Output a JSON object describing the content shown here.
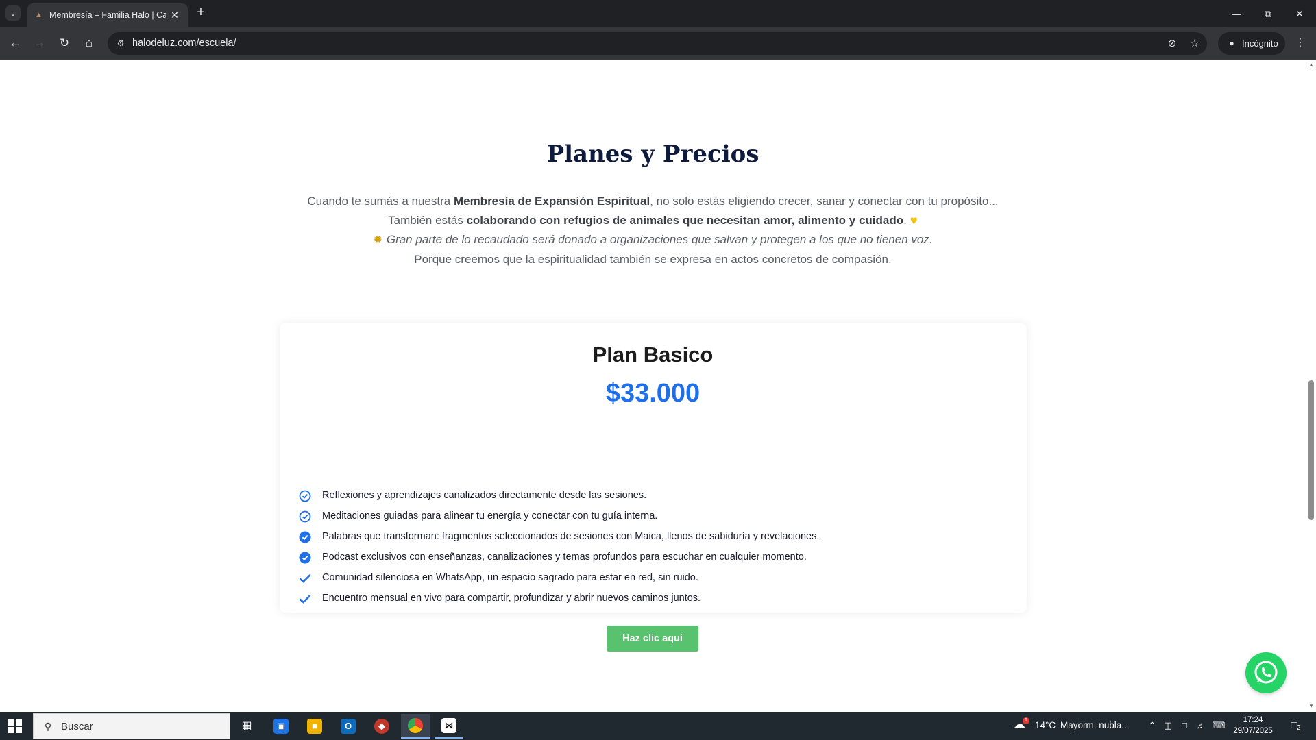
{
  "browser": {
    "tab_title": "Membresía – Familia Halo | Can",
    "url": "halodeluz.com/escuela/",
    "incognito_label": "Incógnito"
  },
  "page": {
    "section_title": "Planes y Precios",
    "intro": {
      "line1_pre": "Cuando te sumás a nuestra ",
      "line1_bold": "Membresía de Expansión Espiritual",
      "line1_post": ", no solo estás eligiendo crecer, sanar y conectar con tu propósito...",
      "line2_pre": "También estás ",
      "line2_bold": "colaborando con refugios de animales que necesitan amor, alimento y cuidado",
      "line2_post": ". ",
      "line3": "Gran parte de lo recaudado será donado a organizaciones que salvan y protegen a los que no tienen voz.",
      "line4": "Porque creemos que la espiritualidad también se expresa en actos concretos de compasión."
    },
    "plan": {
      "name": "Plan Basico",
      "price": "$33.000",
      "features": [
        "Reflexiones y aprendizajes canalizados directamente desde las sesiones.",
        "Meditaciones guiadas para alinear tu energía y conectar con tu guía interna.",
        "Palabras que transforman: fragmentos seleccionados de sesiones con Maica, llenos de sabiduría y revelaciones.",
        "Podcast exclusivos con enseñanzas, canalizaciones y temas profundos para escuchar en cualquier momento.",
        "Comunidad silenciosa en WhatsApp, un espacio sagrado para estar en red, sin ruido.",
        "Encuentro mensual en vivo para compartir, profundizar y abrir nuevos caminos juntos."
      ],
      "cta_label": "Haz clic aquí"
    },
    "colors": {
      "price": "#1e6fe8",
      "cta": "#59c26e",
      "title": "#0f1b3d",
      "whatsapp": "#25d366"
    }
  },
  "taskbar": {
    "search_label": "Buscar",
    "weather_temp": "14°C",
    "weather_desc": "Mayorm. nubla...",
    "time": "17:24",
    "date": "29/07/2025",
    "weather_badge": "1",
    "notifications": "2"
  }
}
